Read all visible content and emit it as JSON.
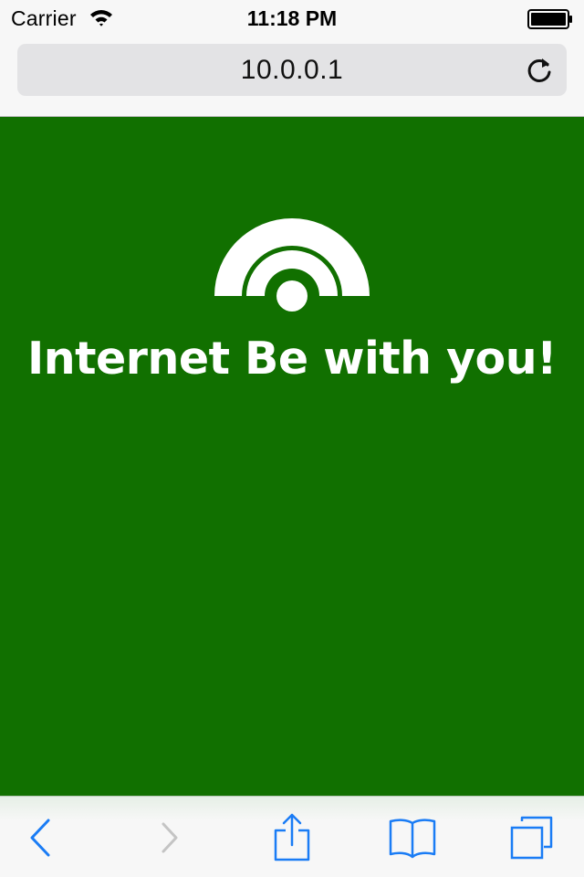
{
  "status_bar": {
    "carrier": "Carrier",
    "time": "11:18 PM",
    "wifi_icon": "wifi-icon",
    "battery_icon": "battery-icon"
  },
  "address_bar": {
    "url": "10.0.0.1",
    "reload_icon": "reload-icon"
  },
  "page": {
    "background_color": "#117000",
    "logo_icon": "wifi-signal-icon",
    "headline": "Internet Be with you!"
  },
  "toolbar": {
    "accent_color": "#1a7cf5",
    "items": [
      {
        "icon": "back-icon",
        "enabled": true
      },
      {
        "icon": "forward-icon",
        "enabled": false
      },
      {
        "icon": "share-icon",
        "enabled": true
      },
      {
        "icon": "bookmarks-icon",
        "enabled": true
      },
      {
        "icon": "tabs-icon",
        "enabled": true
      }
    ]
  }
}
